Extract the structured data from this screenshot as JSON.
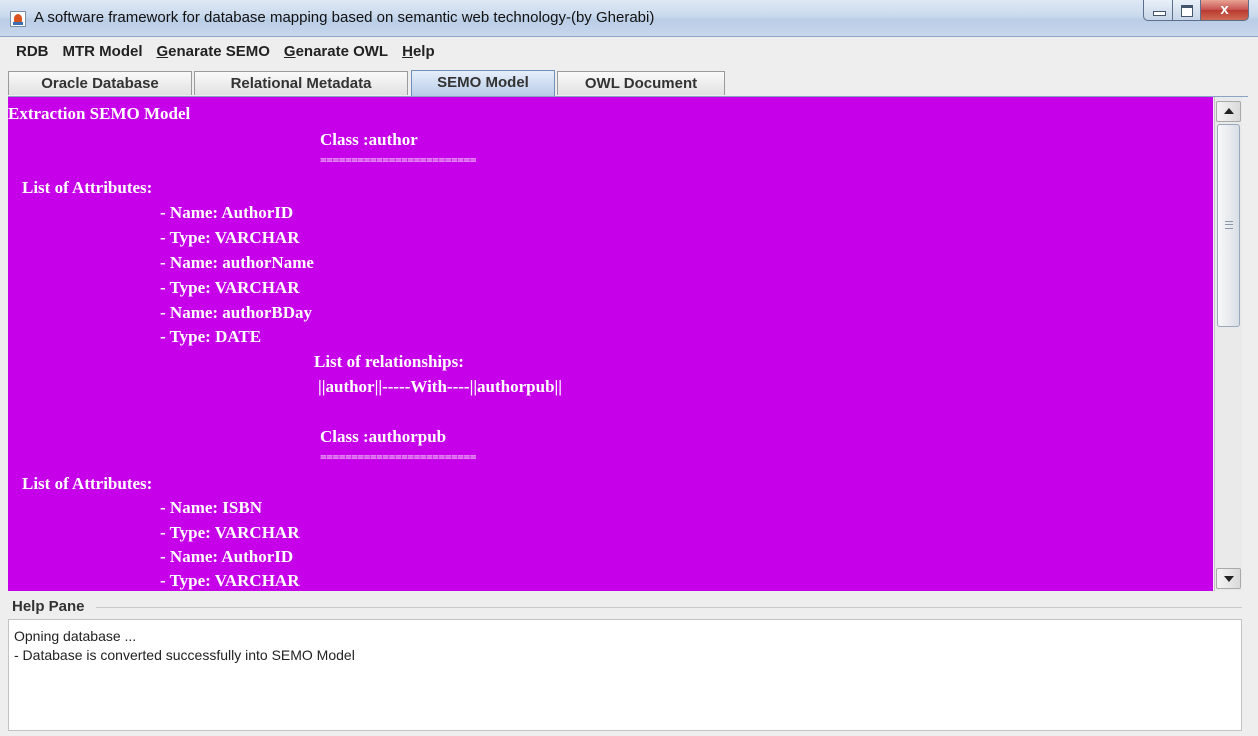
{
  "window": {
    "title": "A software framework for database mapping based on semantic web technology-(by Gherabi)",
    "close_glyph": "x"
  },
  "menu": [
    {
      "label": "RDB",
      "mnemonic": "",
      "rest": "RDB"
    },
    {
      "label": "MTR Model",
      "mnemonic": "",
      "rest": "MTR Model"
    },
    {
      "label": "Genarate SEMO",
      "mnemonic": "G",
      "rest": "enarate SEMO"
    },
    {
      "label": "Genarate OWL",
      "mnemonic": "G",
      "rest": "enarate OWL"
    },
    {
      "label": "Help",
      "mnemonic": "H",
      "rest": "elp"
    }
  ],
  "tabs": [
    {
      "label": "Oracle Database",
      "active": false
    },
    {
      "label": "Relational Metadata",
      "active": false
    },
    {
      "label": "SEMO Model",
      "active": true
    },
    {
      "label": "OWL Document",
      "active": false
    }
  ],
  "content": {
    "background": "#c600e8",
    "heading": "Extraction SEMO Model",
    "class1": {
      "title": "Class :author",
      "underline": "=========================",
      "attrs_heading": "List of Attributes:",
      "attributes": [
        "- Name: AuthorID",
        "- Type: VARCHAR",
        "- Name: authorName",
        "- Type: VARCHAR",
        "- Name: authorBDay",
        "- Type: DATE"
      ],
      "rel_heading": "List of relationships:",
      "relationship": "||author||-----With----||authorpub||"
    },
    "class2": {
      "title": "Class :authorpub",
      "underline": "=========================",
      "attrs_heading": "List of Attributes:",
      "attributes": [
        "- Name: ISBN",
        "- Type: VARCHAR",
        "- Name: AuthorID",
        "- Type: VARCHAR"
      ]
    }
  },
  "help_pane": {
    "title": "Help Pane",
    "lines": [
      "Opning  database ...",
      "-  Database is converted successfully into SEMO Model"
    ]
  }
}
